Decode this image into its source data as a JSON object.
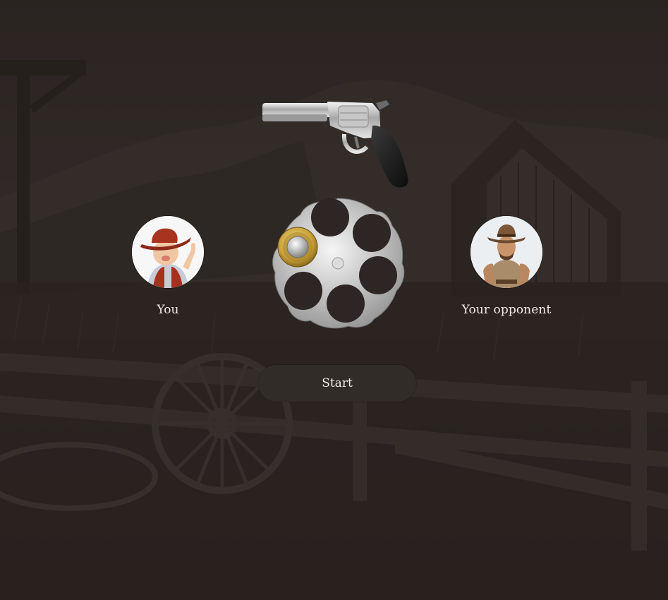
{
  "players": {
    "you": {
      "label": "You"
    },
    "opponent": {
      "label": "Your opponent"
    }
  },
  "game": {
    "cylinder_chambers": 6,
    "bullets_loaded": 1,
    "start_label": "Start"
  },
  "icons": {
    "weapon": "revolver-icon",
    "cylinder": "revolver-cylinder-icon",
    "bullet": "bullet-icon"
  },
  "colors": {
    "background": "#2e2624",
    "button": "#322c28",
    "text": "#f1ece8"
  }
}
